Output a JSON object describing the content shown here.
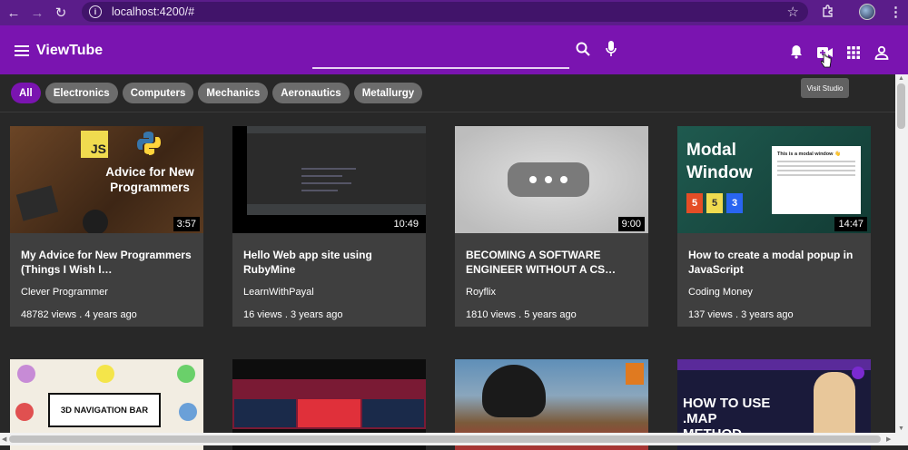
{
  "browser": {
    "url": "localhost:4200/#"
  },
  "header": {
    "brand": "ViewTube",
    "tooltip": "Visit Studio"
  },
  "chips": [
    "All",
    "Electronics",
    "Computers",
    "Mechanics",
    "Aeronautics",
    "Metallurgy"
  ],
  "videos": [
    {
      "title": "My Advice for New Programmers (Things I Wish I…",
      "channel": "Clever Programmer",
      "meta": "48782 views . 4 years ago",
      "duration": "3:57",
      "thumb_text": "Advice for New Programmers",
      "thumb_badge": "JS"
    },
    {
      "title": "Hello Web app site using RubyMine",
      "channel": "LearnWithPayal",
      "meta": "16 views . 3 years ago",
      "duration": "10:49"
    },
    {
      "title": "BECOMING A SOFTWARE ENGINEER WITHOUT A CS…",
      "channel": "Royflix",
      "meta": "1810 views . 5 years ago",
      "duration": "9:00"
    },
    {
      "title": "How to create a modal popup in JavaScript",
      "channel": "Coding Money",
      "meta": "137 views . 3 years ago",
      "duration": "14:47",
      "thumb_text": "Modal Window",
      "thumb_popup": "This is a modal window 👋"
    }
  ],
  "row2": [
    {
      "thumb_text": "3D NAVIGATION BAR"
    },
    {
      "thumb_text": ""
    },
    {
      "thumb_text": ""
    },
    {
      "thumb_text": "HOW TO USE .MAP METHOD"
    }
  ],
  "icons": {
    "back": "arrow-left-icon",
    "forward": "arrow-right-icon",
    "reload": "reload-icon",
    "menu": "hamburger-icon",
    "search": "search-icon",
    "mic": "mic-icon",
    "bell": "bell-icon",
    "camera": "video-camera-icon",
    "apps": "apps-grid-icon",
    "account": "account-icon"
  },
  "colors": {
    "header": "#7a14b0",
    "browser": "#5b1d8a",
    "chip_active": "#7a14b0",
    "chip": "#6c6c6c",
    "card": "#3f3f3f",
    "background": "#282828"
  }
}
